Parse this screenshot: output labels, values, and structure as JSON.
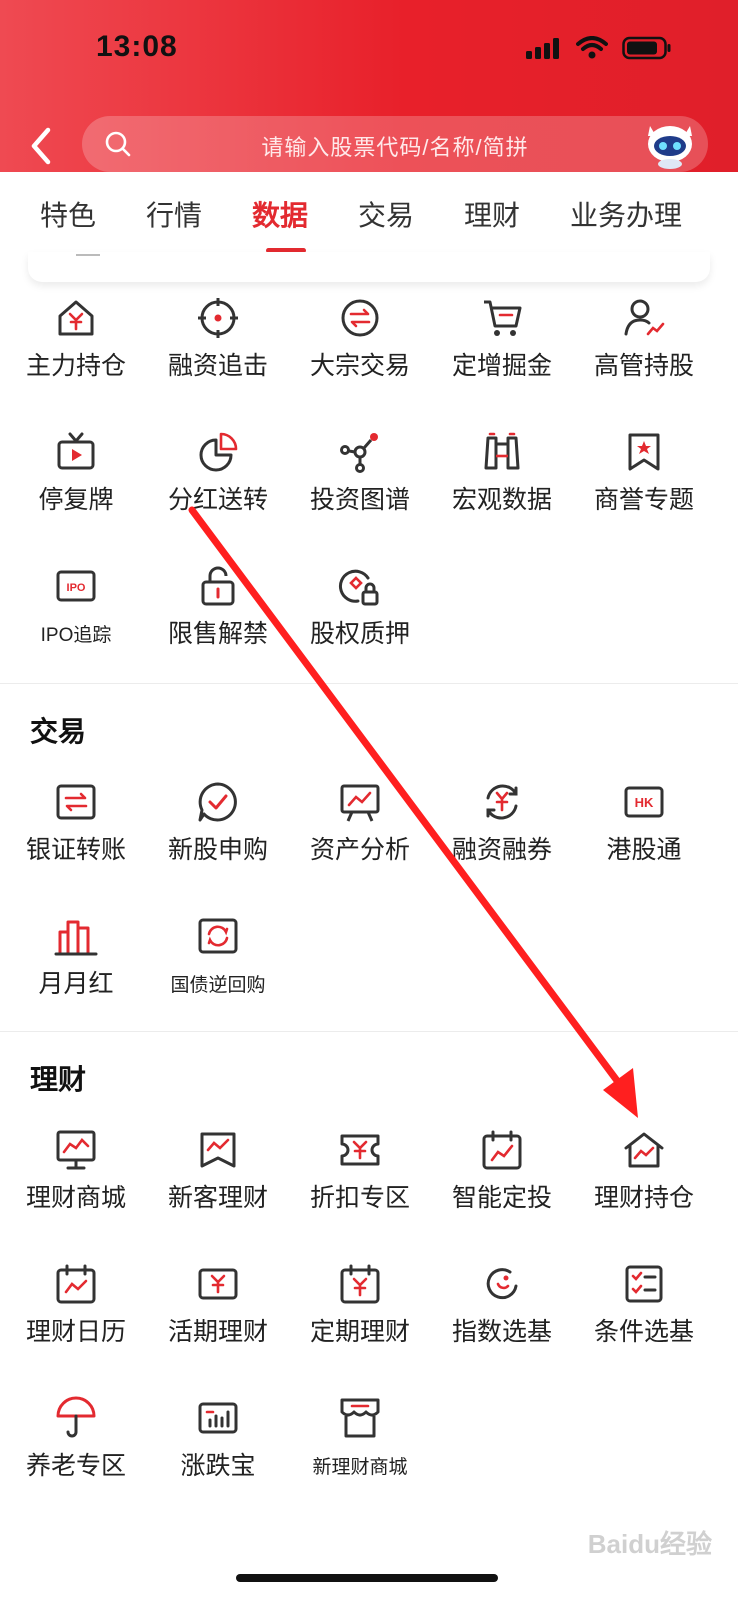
{
  "status_bar": {
    "time": "13:08"
  },
  "search": {
    "placeholder": "请输入股票代码/名称/简拼"
  },
  "tabs": [
    {
      "label": "特色"
    },
    {
      "label": "行情"
    },
    {
      "label": "数据",
      "active": true
    },
    {
      "label": "交易"
    },
    {
      "label": "理财"
    },
    {
      "label": "业务办理"
    }
  ],
  "data_section": {
    "items": [
      {
        "label": "主力持仓",
        "icon": "house-yen-icon"
      },
      {
        "label": "融资追击",
        "icon": "target-icon"
      },
      {
        "label": "大宗交易",
        "icon": "exchange-icon"
      },
      {
        "label": "定增掘金",
        "icon": "cart-icon"
      },
      {
        "label": "高管持股",
        "icon": "person-chart-icon"
      },
      {
        "label": "停复牌",
        "icon": "tv-play-icon"
      },
      {
        "label": "分红送转",
        "icon": "pie-chart-icon"
      },
      {
        "label": "投资图谱",
        "icon": "network-icon"
      },
      {
        "label": "宏观数据",
        "icon": "binoculars-icon"
      },
      {
        "label": "商誉专题",
        "icon": "bookmark-star-icon"
      },
      {
        "label": "IPO追踪",
        "icon": "ipo-icon"
      },
      {
        "label": "限售解禁",
        "icon": "unlock-icon"
      },
      {
        "label": "股权质押",
        "icon": "pledge-lock-icon"
      }
    ]
  },
  "trade_section": {
    "title": "交易",
    "items": [
      {
        "label": "银证转账",
        "icon": "transfer-icon"
      },
      {
        "label": "新股申购",
        "icon": "check-bubble-icon"
      },
      {
        "label": "资产分析",
        "icon": "presentation-chart-icon"
      },
      {
        "label": "融资融券",
        "icon": "yen-cycle-icon"
      },
      {
        "label": "港股通",
        "icon": "hk-icon"
      },
      {
        "label": "月月红",
        "icon": "buildings-icon"
      },
      {
        "label": "国债逆回购",
        "icon": "repo-icon"
      }
    ]
  },
  "wealth_section": {
    "title": "理财",
    "items": [
      {
        "label": "理财商城",
        "icon": "monitor-chart-icon"
      },
      {
        "label": "新客理财",
        "icon": "ribbon-chart-icon"
      },
      {
        "label": "折扣专区",
        "icon": "ticket-yen-icon"
      },
      {
        "label": "智能定投",
        "icon": "calendar-trend-icon"
      },
      {
        "label": "理财持仓",
        "icon": "house-chart-icon"
      },
      {
        "label": "理财日历",
        "icon": "calendar-chart-icon"
      },
      {
        "label": "活期理财",
        "icon": "card-yen-icon"
      },
      {
        "label": "定期理财",
        "icon": "calendar-yen-icon"
      },
      {
        "label": "指数选基",
        "icon": "index-fund-icon"
      },
      {
        "label": "条件选基",
        "icon": "checklist-icon"
      },
      {
        "label": "养老专区",
        "icon": "umbrella-icon"
      },
      {
        "label": "涨跌宝",
        "icon": "bar-chart-icon"
      },
      {
        "label": "新理财商城",
        "icon": "store-icon"
      }
    ]
  },
  "colors": {
    "brand_red": "#e32a30",
    "icon_dark": "#333333"
  },
  "watermark": "Baidu经验"
}
